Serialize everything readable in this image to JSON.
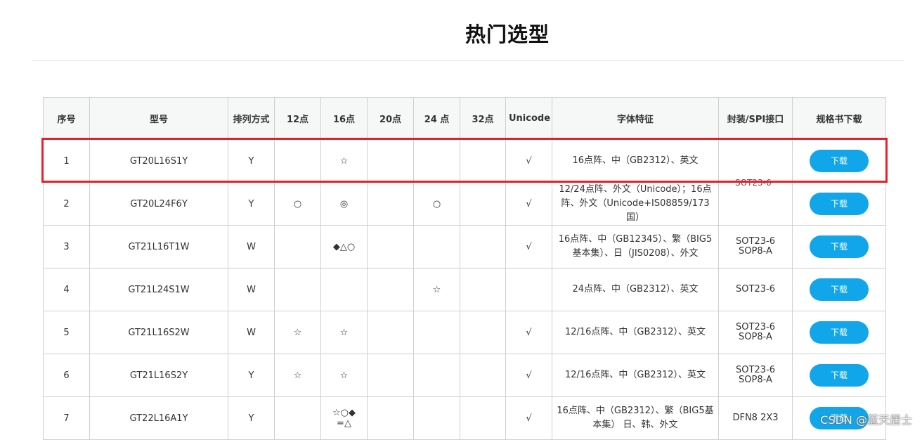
{
  "page": {
    "title": "热门选型",
    "watermark": "CSDN @蓝天居士"
  },
  "table": {
    "headers": [
      "序号",
      "型号",
      "排列方式",
      "12点",
      "16点",
      "20点",
      "24 点",
      "32点",
      "Unicode",
      "字体特征",
      "封装/SPI接口",
      "规格书下载"
    ],
    "rows": [
      {
        "idx": "1",
        "model": "GT20L16S1Y",
        "arr": "Y",
        "p12": "",
        "p16": "☆",
        "p20": "",
        "p24": "",
        "p32": "",
        "unicode": "√",
        "feature": "16点阵、中（GB2312）、英文",
        "package": "",
        "download": "下载"
      },
      {
        "idx": "2",
        "model": "GT20L24F6Y",
        "arr": "Y",
        "p12": "○",
        "p16": "◎",
        "p20": "",
        "p24": "○",
        "p32": "",
        "unicode": "√",
        "feature": "12/24点阵、外文（Unicode）；16点阵、外文（Unicode+IS08859/173国）",
        "package": "",
        "download": "下载"
      },
      {
        "idx": "3",
        "model": "GT21L16T1W",
        "arr": "W",
        "p12": "",
        "p16": "◆△○",
        "p20": "",
        "p24": "",
        "p32": "",
        "unicode": "√",
        "feature": "16点阵、中（GB12345）、繁（BIG5基本集）、日（JIS0208）、外文",
        "package": "SOT23-6 SOP8-A",
        "download": "下载"
      },
      {
        "idx": "4",
        "model": "GT21L24S1W",
        "arr": "W",
        "p12": "",
        "p16": "",
        "p20": "",
        "p24": "☆",
        "p32": "",
        "unicode": "",
        "feature": "24点阵、中（GB2312）、英文",
        "package": "SOT23-6",
        "download": "下载"
      },
      {
        "idx": "5",
        "model": "GT21L16S2W",
        "arr": "W",
        "p12": "☆",
        "p16": "☆",
        "p20": "",
        "p24": "",
        "p32": "",
        "unicode": "√",
        "feature": "12/16点阵、中（GB2312）、英文",
        "package": "SOT23-6 SOP8-A",
        "download": "下载"
      },
      {
        "idx": "6",
        "model": "GT21L16S2Y",
        "arr": "Y",
        "p12": "☆",
        "p16": "☆",
        "p20": "",
        "p24": "",
        "p32": "",
        "unicode": "√",
        "feature": "12/16点阵、中（GB2312）、英文",
        "package": "SOT23-6 SOP8-A",
        "download": "下载"
      },
      {
        "idx": "7",
        "model": "GT22L16A1Y",
        "arr": "Y",
        "p12": "",
        "p16": "☆○◆ =△",
        "p20": "",
        "p24": "",
        "p32": "",
        "unicode": "√",
        "feature": "16点阵、中（GB2312）、繁（BIG5基本集） 日、韩、外文",
        "package": "DFN8 2X3",
        "download": "下载"
      }
    ],
    "merged_package_label": "SOT23-6"
  },
  "colors": {
    "highlight": "#e8202a",
    "button": "#11a6ea",
    "header_bg": "#f6f8f7"
  }
}
